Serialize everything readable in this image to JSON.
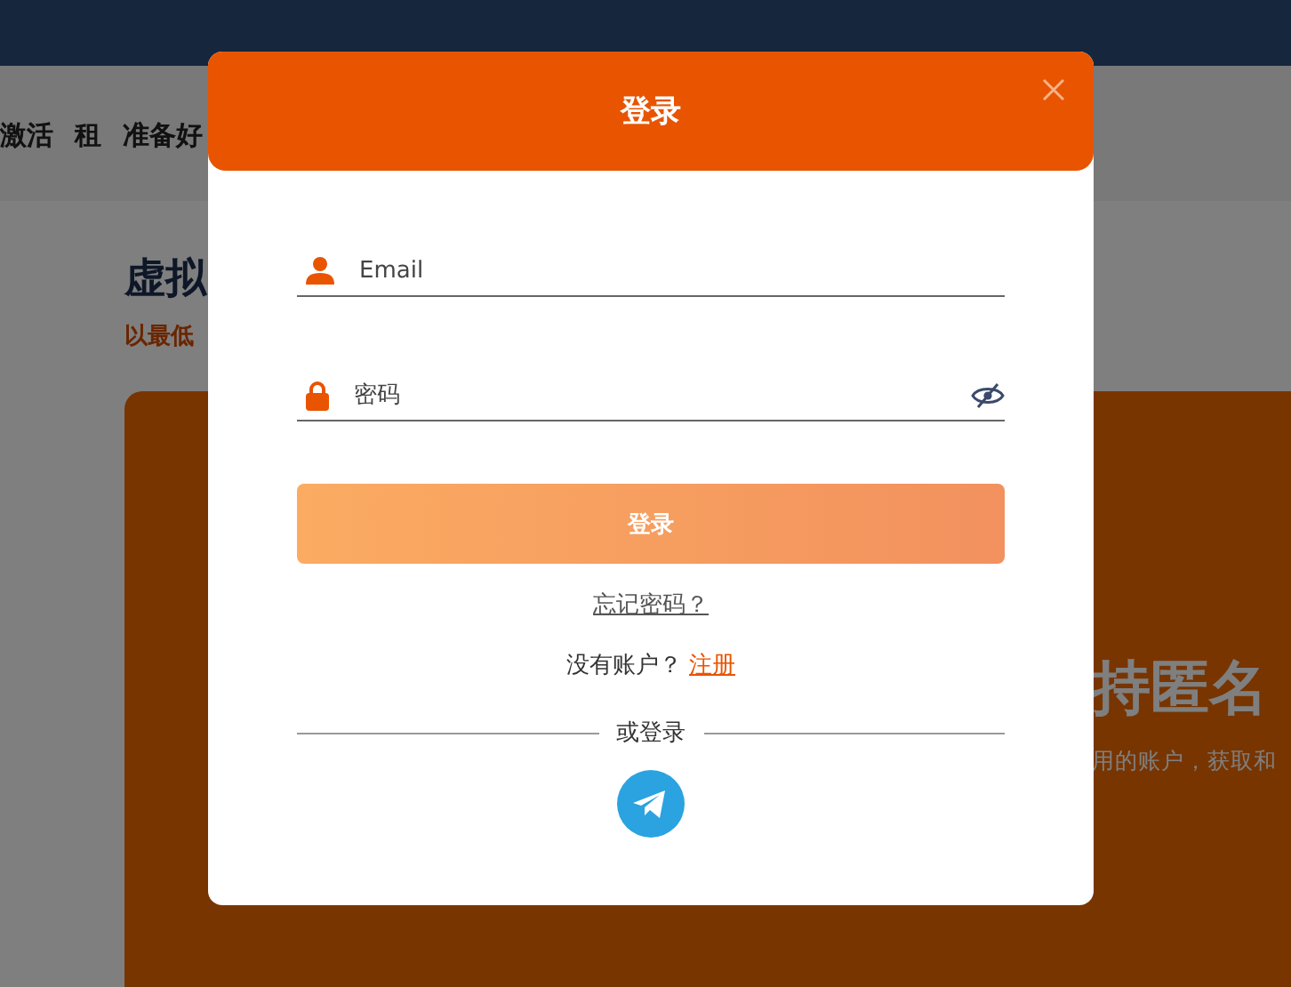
{
  "background": {
    "nav": [
      "激活",
      "租",
      "准备好"
    ],
    "heading": "虚拟",
    "subtitle": "以最低",
    "banner": {
      "title": "持匿名",
      "text": "用的账户，获取和"
    }
  },
  "dialog": {
    "title": "登录",
    "fields": [
      {
        "kind": "email",
        "placeholder": "Email"
      },
      {
        "kind": "password",
        "placeholder": "密码"
      }
    ],
    "submit": "登录",
    "forgot": "忘记密码？",
    "signup_prompt": "没有账户？",
    "signup_link": "注册",
    "divider": "或登录"
  }
}
